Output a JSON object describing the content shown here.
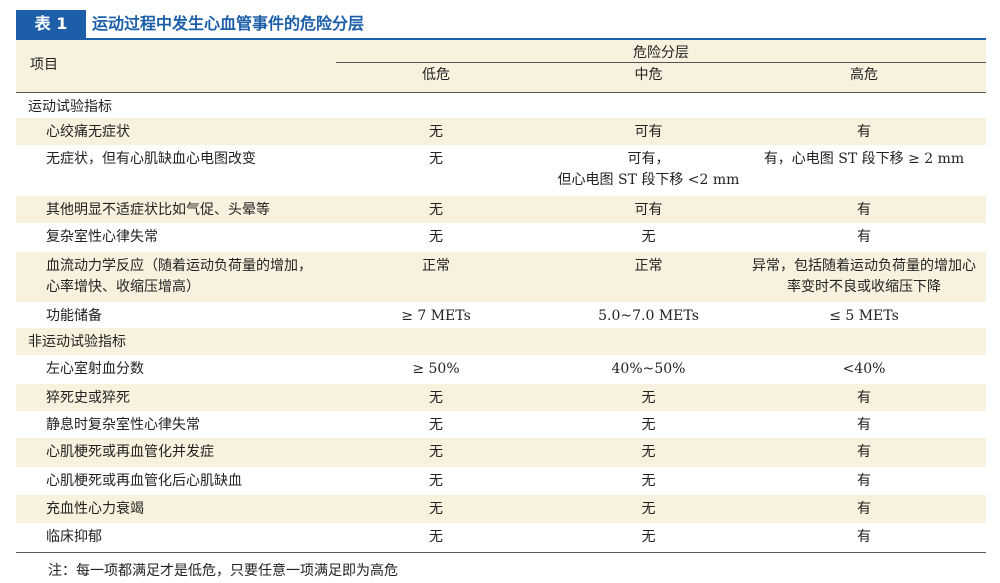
{
  "title": {
    "label": "表 1",
    "text": "运动过程中发生心血管事件的危险分层"
  },
  "header": {
    "item": "项目",
    "group": "危险分层",
    "levels": [
      "低危",
      "中危",
      "高危"
    ]
  },
  "rows": [
    {
      "name": "运动试验指标",
      "section": true
    },
    {
      "name": "心绞痛无症状",
      "low": "无",
      "mid": "可有",
      "high": "有"
    },
    {
      "name": "无症状，但有心肌缺血心电图改变",
      "low": "无",
      "mid": "可有，",
      "mid2": "但心电图 ST 段下移 <2 mm",
      "high": "有，心电图 ST 段下移 ≥ 2 mm"
    },
    {
      "name": "其他明显不适症状比如气促、头晕等",
      "low": "无",
      "mid": "可有",
      "high": "有"
    },
    {
      "name": "复杂室性心律失常",
      "low": "无",
      "mid": "无",
      "high": "有"
    },
    {
      "name": "血流动力学反应（随着运动负荷量的增加，",
      "name2": "心率增快、收缩压增高）",
      "low": "正常",
      "mid": "正常",
      "high": "异常，包括随着运动负荷量的增加心",
      "high2": "率变时不良或收缩压下降"
    },
    {
      "name": "功能储备",
      "low": "≥ 7 METs",
      "mid": "5.0~7.0 METs",
      "high": "≤ 5 METs"
    },
    {
      "name": "非运动试验指标",
      "section": true
    },
    {
      "name": "左心室射血分数",
      "low": "≥ 50%",
      "mid": "40%~50%",
      "high": "<40%"
    },
    {
      "name": "猝死史或猝死",
      "low": "无",
      "mid": "无",
      "high": "有"
    },
    {
      "name": "静息时复杂室性心律失常",
      "low": "无",
      "mid": "无",
      "high": "有"
    },
    {
      "name": "心肌梗死或再血管化并发症",
      "low": "无",
      "mid": "无",
      "high": "有"
    },
    {
      "name": "心肌梗死或再血管化后心肌缺血",
      "low": "无",
      "mid": "无",
      "high": "有"
    },
    {
      "name": "充血性心力衰竭",
      "low": "无",
      "mid": "无",
      "high": "有"
    },
    {
      "name": "临床抑郁",
      "low": "无",
      "mid": "无",
      "high": "有"
    }
  ],
  "note": "注：每一项都满足才是低危，只要任意一项满足即为高危",
  "colors": {
    "accent": "#1c5fa8",
    "shade": "#f7f1de"
  }
}
